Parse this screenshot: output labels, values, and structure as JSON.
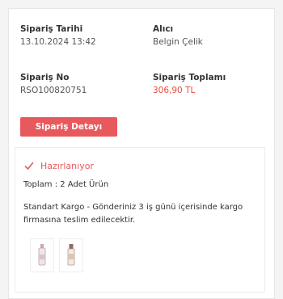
{
  "order": {
    "date_label": "Sipariş Tarihi",
    "date_value": "13.10.2024 13:42",
    "recipient_label": "Alıcı",
    "recipient_value": "Belgin Çelik",
    "number_label": "Sipariş No",
    "number_value": "RSO100820751",
    "total_label": "Sipariş Toplamı",
    "total_value": "306,90 TL",
    "details_button": "Sipariş Detayı"
  },
  "shipment": {
    "status": "Hazırlanıyor",
    "item_count": "Toplam : 2 Adet Ürün",
    "cargo_info": "Standart Kargo - Gönderiniz 3 iş günü içerisinde kargo firmasına teslim edilecektir.",
    "thumbnails": [
      "product-thumbnail-1",
      "product-thumbnail-2"
    ]
  },
  "colors": {
    "accent": "#e8595e",
    "price": "#e74c3c"
  }
}
